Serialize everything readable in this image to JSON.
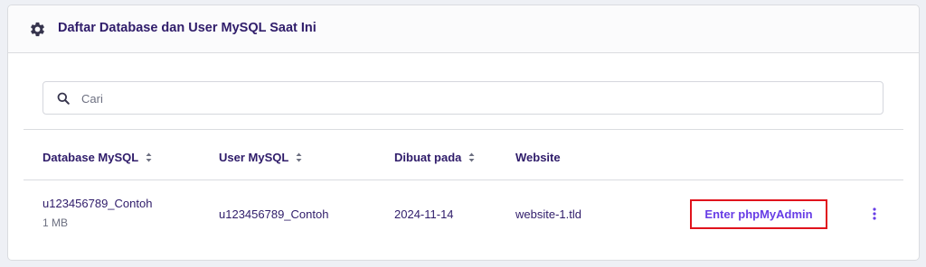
{
  "card": {
    "title": "Daftar Database dan User MySQL Saat Ini",
    "header_icon": "gear-icon"
  },
  "search": {
    "placeholder": "Cari",
    "value": "",
    "icon": "search-icon"
  },
  "table": {
    "columns": [
      {
        "label": "Database MySQL",
        "sortable": true
      },
      {
        "label": "User MySQL",
        "sortable": true
      },
      {
        "label": "Dibuat pada",
        "sortable": true
      },
      {
        "label": "Website",
        "sortable": false
      }
    ],
    "rows": [
      {
        "database": "u123456789_Contoh",
        "size": "1 MB",
        "user": "u123456789_Contoh",
        "created": "2024-11-14",
        "website": "website-1.tld",
        "action_label": "Enter phpMyAdmin",
        "menu_icon": "kebab-menu-icon"
      }
    ]
  },
  "colors": {
    "text_primary": "#2f1c6a",
    "text_secondary": "#6d7081",
    "accent": "#673de6",
    "highlight_border": "#e0131c",
    "page_bg": "#eef0f5",
    "border": "#dadce0"
  }
}
